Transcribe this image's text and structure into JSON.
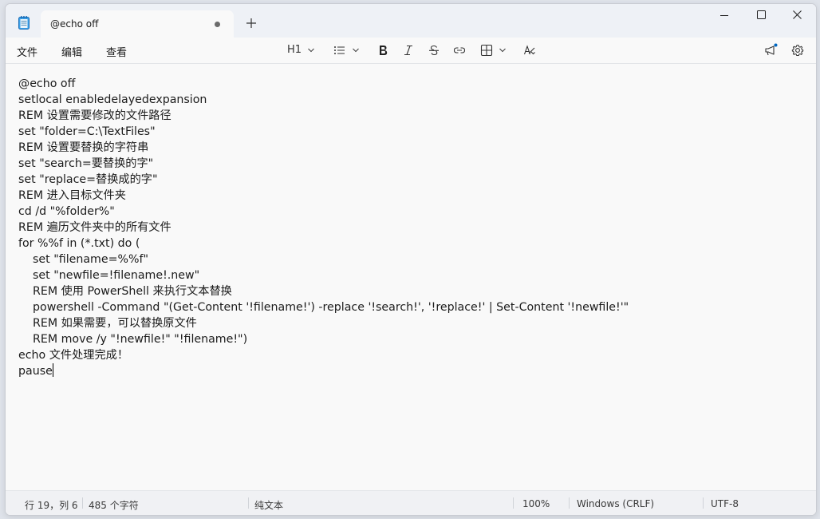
{
  "tab": {
    "title": "@echo off"
  },
  "menu": {
    "file": "文件",
    "edit": "编辑",
    "view": "查看"
  },
  "toolbar": {
    "heading": "H1"
  },
  "editor": {
    "lines": [
      "@echo off",
      "setlocal enabledelayedexpansion",
      "REM 设置需要修改的文件路径",
      "set \"folder=C:\\TextFiles\"",
      "REM 设置要替换的字符串",
      "set \"search=要替换的字\"",
      "set \"replace=替换成的字\"",
      "REM 进入目标文件夹",
      "cd /d \"%folder%\"",
      "REM 遍历文件夹中的所有文件",
      "for %%f in (*.txt) do (",
      "    set \"filename=%%f\"",
      "    set \"newfile=!filename!.new\"",
      "    REM 使用 PowerShell 来执行文本替换",
      "    powershell -Command \"(Get-Content '!filename!') -replace '!search!', '!replace!' | Set-Content '!newfile!'\"",
      "    REM 如果需要，可以替换原文件",
      "    REM move /y \"!newfile!\" \"!filename!\")",
      "echo 文件处理完成！",
      "pause"
    ]
  },
  "status": {
    "position": "行 19，列 6",
    "chars": "485 个字符",
    "format": "纯文本",
    "zoom": "100%",
    "line_ending": "Windows (CRLF)",
    "encoding": "UTF-8"
  },
  "colors": {
    "accent": "#0067c0",
    "titlebar": "#eef1f6",
    "editor_bg": "#f9f9f9"
  }
}
